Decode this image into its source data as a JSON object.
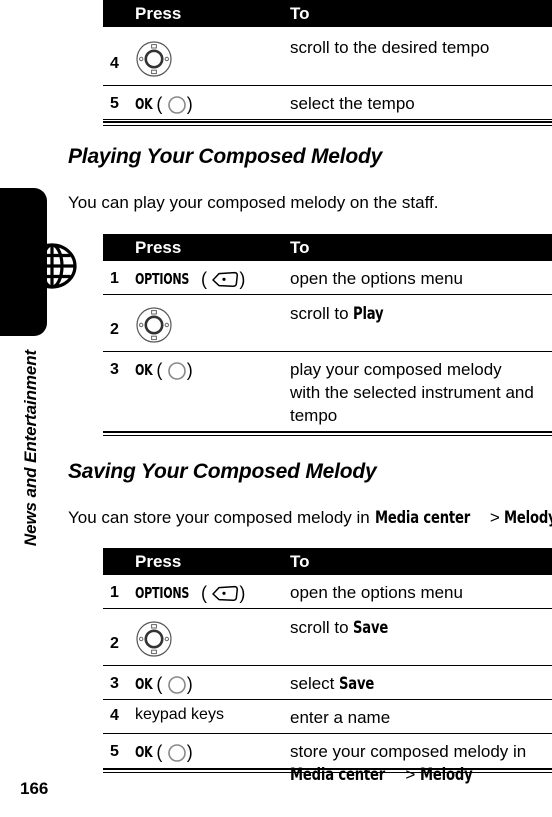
{
  "sidebar": {
    "label": "News and Entertainment",
    "icon": "globe-icon"
  },
  "page_number": "166",
  "table_headers": {
    "press": "Press",
    "to": "To"
  },
  "icons": {
    "nav_key": "navigation-key-icon",
    "ok_key": "ok-center-key-icon",
    "soft_key": "left-soft-key-icon"
  },
  "tables": {
    "tempo": {
      "rows": [
        {
          "num": "4",
          "press_label": "",
          "press_icon": "nav-key",
          "to": "scroll to the desired tempo"
        },
        {
          "num": "5",
          "press_label": "OK",
          "press_icon": "ok-key",
          "to": "select the tempo"
        }
      ]
    },
    "playing": {
      "rows": [
        {
          "num": "1",
          "press_label": "OPTIONS",
          "press_icon": "soft-key",
          "to": "open the options menu"
        },
        {
          "num": "2",
          "press_label": "",
          "press_icon": "nav-key",
          "to_prefix": "scroll to ",
          "to_bold": "Play"
        },
        {
          "num": "3",
          "press_label": "OK",
          "press_icon": "ok-key",
          "to": "play your composed melody with the selected instrument and tempo"
        }
      ]
    },
    "saving": {
      "rows": [
        {
          "num": "1",
          "press_label": "OPTIONS",
          "press_icon": "soft-key",
          "to": "open the options menu"
        },
        {
          "num": "2",
          "press_label": "",
          "press_icon": "nav-key",
          "to_prefix": "scroll to ",
          "to_bold": "Save"
        },
        {
          "num": "3",
          "press_label": "OK",
          "press_icon": "ok-key",
          "to_prefix": "select ",
          "to_bold": "Save"
        },
        {
          "num": "4",
          "press_label": "keypad keys",
          "press_icon": "",
          "to": "enter a name"
        },
        {
          "num": "5",
          "press_label": "OK",
          "press_icon": "ok-key",
          "to_prefix": "store your composed melody in ",
          "to_bold1": "Media center",
          "to_sep": " > ",
          "to_bold2": "Melody"
        }
      ]
    }
  },
  "sections": [
    {
      "heading": "Playing Your Composed Melody",
      "intro": "You can play your composed melody on the staff."
    },
    {
      "heading": "Saving Your Composed Melody",
      "intro_prefix": "You can store your composed melody in ",
      "intro_bold1": "Media center",
      "intro_sep": " > ",
      "intro_bold2": "Melody",
      "intro_suffix": "."
    }
  ]
}
